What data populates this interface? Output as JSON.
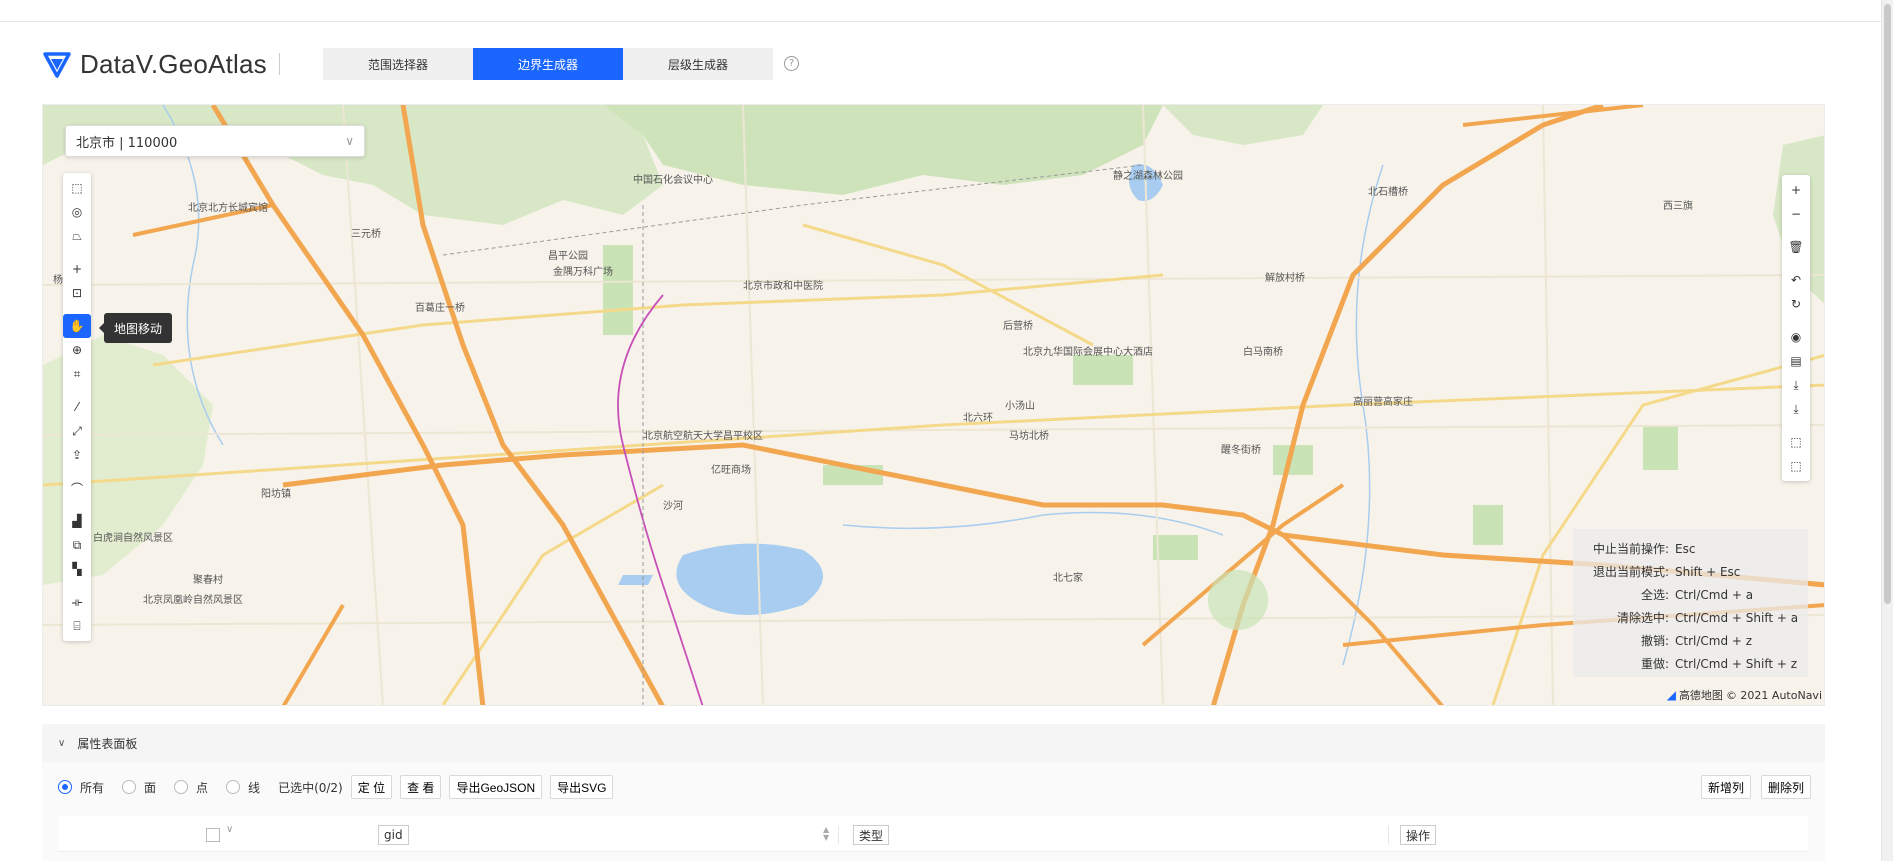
{
  "app": {
    "title": "DataV.GeoAtlas",
    "help_label": "?",
    "tabs": [
      {
        "label": "范围选择器",
        "active": false
      },
      {
        "label": "边界生成器",
        "active": true
      },
      {
        "label": "层级生成器",
        "active": false
      }
    ],
    "accent_color": "#1a66ff"
  },
  "map": {
    "region_select": {
      "value": "北京市 | 110000",
      "chevron": "∨"
    },
    "left_tools": {
      "icons": [
        "rectangle-select-icon",
        "circle-select-icon",
        "polygon-select-icon",
        "point-add-icon",
        "focus-icon",
        "pan-icon",
        "brush-select-icon",
        "crop-select-icon",
        "line-draw-icon",
        "line-edit-icon",
        "upload-icon",
        "bridge-icon",
        "layer-front-icon",
        "layer-copy-icon",
        "layer-merge-icon",
        "split-icon",
        "crop-icon"
      ],
      "active_tool": "pan-icon",
      "tooltip": "地图移动"
    },
    "right_tools": {
      "icons": [
        "zoom-in-icon",
        "zoom-out-icon",
        "delete-icon",
        "undo-icon",
        "redo-icon",
        "locate-icon",
        "file-icon",
        "download-icon",
        "download-alt-icon",
        "select-all-icon",
        "deselect-icon"
      ]
    },
    "shortcuts": [
      {
        "key": "中止当前操作:",
        "value": "Esc"
      },
      {
        "key": "退出当前模式:",
        "value": "Shift + Esc"
      },
      {
        "key": "全选:",
        "value": "Ctrl/Cmd + a"
      },
      {
        "key": "清除选中:",
        "value": "Ctrl/Cmd + Shift + a"
      },
      {
        "key": "撤销:",
        "value": "Ctrl/Cmd + z"
      },
      {
        "key": "重做:",
        "value": "Ctrl/Cmd + Shift + z"
      }
    ],
    "attribution": {
      "logo": "高德地图",
      "copyright": "© 2021 AutoNavi"
    },
    "labels": [
      {
        "text": "北京市政和中医院"
      },
      {
        "text": "北京九华国际会展中心大酒店"
      },
      {
        "text": "亿旺商场"
      },
      {
        "text": "北京航空航天大学昌平校区"
      },
      {
        "text": "北京北方长城宾馆"
      },
      {
        "text": "中国石化会议中心"
      },
      {
        "text": "静之湖森林公园"
      },
      {
        "text": "北石槽桥"
      },
      {
        "text": "解放村桥"
      },
      {
        "text": "白马南桥"
      },
      {
        "text": "北六环"
      },
      {
        "text": "马坊北桥"
      },
      {
        "text": "醒冬街桥"
      },
      {
        "text": "小汤山"
      },
      {
        "text": "沙河"
      },
      {
        "text": "昌平公园"
      },
      {
        "text": "金隅万科广场"
      },
      {
        "text": "百葛庄一桥"
      },
      {
        "text": "西三旗"
      },
      {
        "text": "杨各庄"
      },
      {
        "text": "后营桥"
      },
      {
        "text": "北七家"
      },
      {
        "text": "北京凤凰岭自然风景区"
      },
      {
        "text": "白虎涧自然风景区"
      },
      {
        "text": "阳坊镇"
      },
      {
        "text": "高丽营高家庄"
      },
      {
        "text": "三元桥"
      },
      {
        "text": "聚春村"
      }
    ]
  },
  "panel": {
    "title": "属性表面板",
    "collapse_icon": "∨",
    "filters": [
      {
        "label": "所有",
        "checked": true
      },
      {
        "label": "面",
        "checked": false
      },
      {
        "label": "点",
        "checked": false
      },
      {
        "label": "线",
        "checked": false
      }
    ],
    "selected_count": "已选中(0/2)",
    "actions": {
      "locate": "定 位",
      "view": "查 看",
      "export_geojson": "导出GeoJSON",
      "export_svg": "导出SVG"
    },
    "right_actions": {
      "add_column": "新增列",
      "delete_column": "删除列"
    },
    "columns": {
      "gid": "gid",
      "type": "类型",
      "ops": "操作"
    }
  }
}
